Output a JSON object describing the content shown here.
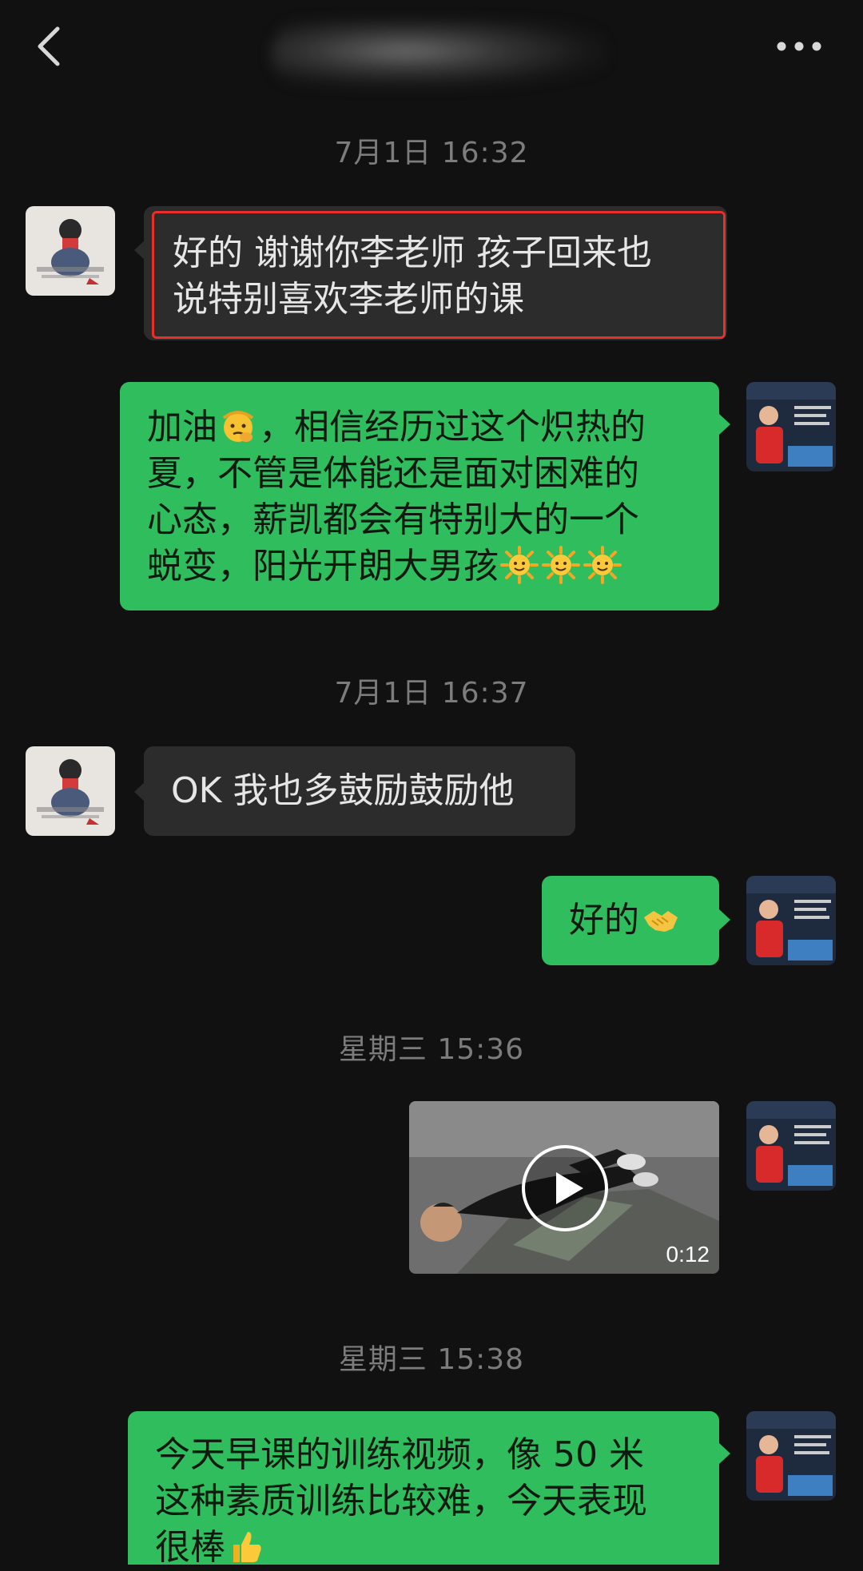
{
  "header": {
    "back_icon": "chevron-left-icon",
    "more_icon": "more-dots-icon",
    "title_blurred": true
  },
  "messages": [
    {
      "type": "timestamp",
      "text": "7月1日 16:32"
    },
    {
      "type": "incoming",
      "text_lines": [
        "好的  谢谢你李老师 孩子回来也",
        "说特别喜欢李老师的课"
      ],
      "highlighted": true,
      "highlight_color": "#e8302a"
    },
    {
      "type": "outgoing",
      "text_lines": [
        "加油",
        "，相信经历过这个炽热的",
        "夏，不管是体能还是面对困难的",
        "心态，薪凯都会有特别大的一个",
        "蜕变，阳光开朗大男孩"
      ],
      "emojis": [
        "thinking-salute-emoji",
        "sun-emoji",
        "sun-emoji",
        "sun-emoji"
      ]
    },
    {
      "type": "timestamp",
      "text": "7月1日 16:37"
    },
    {
      "type": "incoming",
      "text": "OK  我也多鼓励鼓励他"
    },
    {
      "type": "outgoing",
      "text": "好的",
      "emojis": [
        "handshake-emoji"
      ]
    },
    {
      "type": "timestamp",
      "text": "星期三 15:36"
    },
    {
      "type": "outgoing_video",
      "duration": "0:12"
    },
    {
      "type": "timestamp",
      "text": "星期三 15:38"
    },
    {
      "type": "outgoing",
      "text_lines": [
        "今天早课的训练视频，像 50 米",
        "这种素质训练比较难，今天表现",
        "很棒"
      ],
      "emojis": [
        "thumbs-up-emoji"
      ]
    }
  ],
  "colors": {
    "background": "#111111",
    "incoming_bubble": "#2c2c2c",
    "outgoing_bubble": "#2fbd5e",
    "timestamp": "#7c7c7c"
  }
}
